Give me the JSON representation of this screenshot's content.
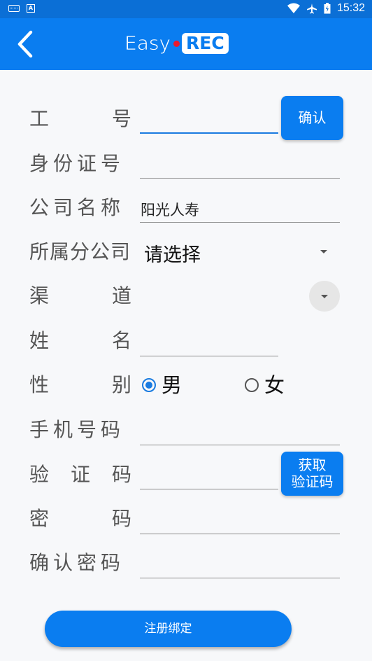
{
  "status_bar": {
    "time": "15:32",
    "icons": [
      "keyboard-icon",
      "a-notification-icon",
      "wifi-icon",
      "airplane-icon",
      "battery-icon"
    ]
  },
  "app_bar": {
    "logo_easy": "Easy",
    "logo_rec": "REC",
    "back_icon": "back-chevron-icon"
  },
  "form": {
    "employee_id": {
      "label_chars": [
        "工",
        "号"
      ],
      "value": "",
      "confirm_label": "确认"
    },
    "id_number": {
      "label": "身份证号",
      "value": ""
    },
    "company_name": {
      "label": "公司名称",
      "value": "阳光人寿"
    },
    "branch": {
      "label": "所属分公司",
      "value": "请选择"
    },
    "channel": {
      "label_chars": [
        "渠",
        "道"
      ],
      "value": ""
    },
    "name": {
      "label_chars": [
        "姓",
        "名"
      ],
      "value": ""
    },
    "gender": {
      "label_chars": [
        "性",
        "别"
      ],
      "options": [
        "男",
        "女"
      ],
      "selected": "男"
    },
    "phone": {
      "label": "手机号码",
      "value": ""
    },
    "verify_code": {
      "label_chars": [
        "验",
        "证",
        "码"
      ],
      "value": "",
      "get_code_line1": "获取",
      "get_code_line2": "验证码"
    },
    "password": {
      "label_chars": [
        "密",
        "码"
      ],
      "value": ""
    },
    "confirm_password": {
      "label": "确认密码",
      "value": ""
    }
  },
  "submit_label": "注册绑定",
  "colors": {
    "primary": "#0a7df0",
    "status_bar": "#0b6fd6",
    "logo_dot": "#e8192c",
    "background": "#f7f8fa"
  }
}
